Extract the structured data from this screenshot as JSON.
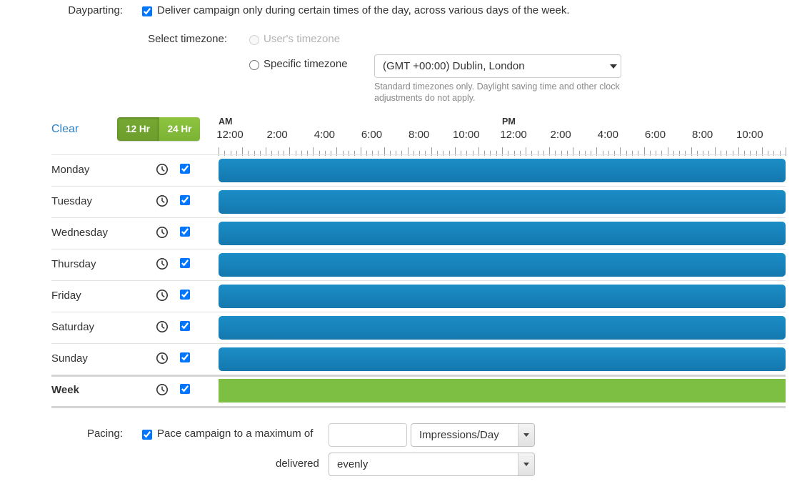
{
  "dayparting": {
    "label": "Dayparting:",
    "deliver_text": "Deliver campaign only during certain times of the day, across various days of the week.",
    "deliver_checked": true,
    "timezone_label": "Select timezone:",
    "users_timezone_option": "User's timezone",
    "specific_timezone_option": "Specific timezone",
    "timezone_selected": "(GMT +00:00) Dublin, London",
    "timezone_help": "Standard timezones only. Daylight saving time and other clock adjustments do not apply."
  },
  "controls": {
    "clear_label": "Clear",
    "hour_12_label": "12 Hr",
    "hour_24_label": "24 Hr",
    "active_format": "12 Hr"
  },
  "ruler": {
    "am_label": "AM",
    "pm_label": "PM",
    "am_ticks": [
      "12:00",
      "2:00",
      "4:00",
      "6:00",
      "8:00",
      "10:00"
    ],
    "pm_ticks": [
      "12:00",
      "2:00",
      "4:00",
      "6:00",
      "8:00",
      "10:00"
    ]
  },
  "schedule": {
    "clock_icon": "clock-icon",
    "checkbox_icon": "checkbox-checked-icon",
    "rows": [
      {
        "day": "Monday",
        "checked": true,
        "bar_color": "#1b8dc6",
        "bar_start": 0,
        "bar_end": 24,
        "type": "day"
      },
      {
        "day": "Tuesday",
        "checked": true,
        "bar_color": "#1b8dc6",
        "bar_start": 0,
        "bar_end": 24,
        "type": "day"
      },
      {
        "day": "Wednesday",
        "checked": true,
        "bar_color": "#1b8dc6",
        "bar_start": 0,
        "bar_end": 24,
        "type": "day"
      },
      {
        "day": "Thursday",
        "checked": true,
        "bar_color": "#1b8dc6",
        "bar_start": 0,
        "bar_end": 24,
        "type": "day"
      },
      {
        "day": "Friday",
        "checked": true,
        "bar_color": "#1b8dc6",
        "bar_start": 0,
        "bar_end": 24,
        "type": "day"
      },
      {
        "day": "Saturday",
        "checked": true,
        "bar_color": "#1b8dc6",
        "bar_start": 0,
        "bar_end": 24,
        "type": "day"
      },
      {
        "day": "Sunday",
        "checked": true,
        "bar_color": "#1b8dc6",
        "bar_start": 0,
        "bar_end": 24,
        "type": "day"
      },
      {
        "day": "Week",
        "checked": true,
        "bar_color": "#7dbf42",
        "bar_start": 0,
        "bar_end": 24,
        "type": "summary"
      }
    ]
  },
  "pacing": {
    "label": "Pacing:",
    "checked": true,
    "pace_text": "Pace campaign to a maximum of",
    "amount_value": "",
    "unit_selected": "Impressions/Day",
    "delivered_label": "delivered",
    "delivery_selected": "evenly"
  },
  "colors": {
    "accent_blue": "#1b8dc6",
    "accent_green": "#7dbf42",
    "link_blue": "#2b7fc4",
    "muted_text": "#b3b3b3"
  }
}
